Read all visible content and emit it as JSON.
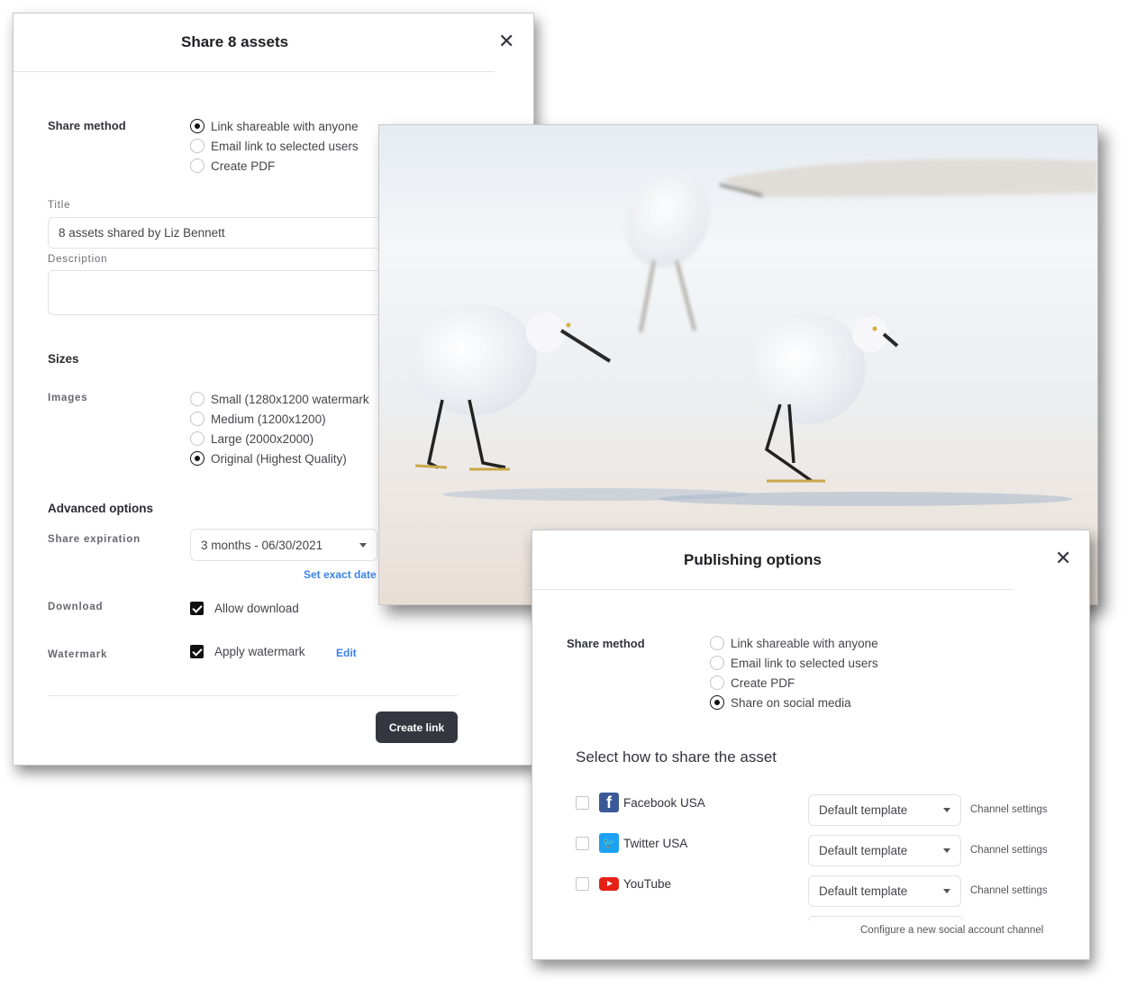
{
  "share_dialog": {
    "title": "Share 8 assets",
    "share_method_label": "Share method",
    "share_methods": [
      {
        "label": "Link shareable with anyone",
        "checked": true
      },
      {
        "label": "Email link to selected users",
        "checked": false
      },
      {
        "label": "Create PDF",
        "checked": false
      }
    ],
    "title_label": "Title",
    "title_value": "8 assets shared by Liz Bennett",
    "description_label": "Description",
    "description_value": "",
    "sizes_heading": "Sizes",
    "images_label": "Images",
    "image_sizes": [
      {
        "label": "Small (1280x1200 watermark",
        "checked": false
      },
      {
        "label": "Medium (1200x1200)",
        "checked": false
      },
      {
        "label": "Large (2000x2000)",
        "checked": false
      },
      {
        "label": "Original (Highest Quality)",
        "checked": true
      }
    ],
    "advanced_heading": "Advanced options",
    "expiration_label": "Share expiration",
    "expiration_value": "3 months - 06/30/2021",
    "set_exact_date": "Set exact date",
    "download_label": "Download",
    "allow_download": {
      "label": "Allow download",
      "checked": true
    },
    "watermark_label": "Watermark",
    "apply_watermark": {
      "label": "Apply watermark",
      "checked": true
    },
    "watermark_edit": "Edit",
    "create_link": "Create link"
  },
  "photo": {
    "subject": "three snowy egrets walking on a beach"
  },
  "publish_dialog": {
    "title": "Publishing options",
    "share_method_label": "Share method",
    "share_methods": [
      {
        "label": "Link shareable with anyone",
        "checked": false
      },
      {
        "label": "Email link to selected users",
        "checked": false
      },
      {
        "label": "Create PDF",
        "checked": false
      },
      {
        "label": "Share on social media",
        "checked": true
      }
    ],
    "select_heading": "Select how to share the asset",
    "channels": [
      {
        "name": "Facebook USA",
        "icon": "facebook-icon",
        "checked": false,
        "template": "Default template",
        "settings": "Channel settings"
      },
      {
        "name": "Twitter USA",
        "icon": "twitter-icon",
        "checked": false,
        "template": "Default template",
        "settings": "Channel settings"
      },
      {
        "name": "YouTube",
        "icon": "youtube-icon",
        "checked": false,
        "template": "Default template",
        "settings": "Channel settings"
      }
    ],
    "configure_new": "Configure a new social account channel"
  },
  "colors": {
    "accent_link": "#3b82e6",
    "button_dark": "#363640",
    "facebook": "#3b5998",
    "twitter": "#1da1f2",
    "youtube": "#e62117"
  }
}
